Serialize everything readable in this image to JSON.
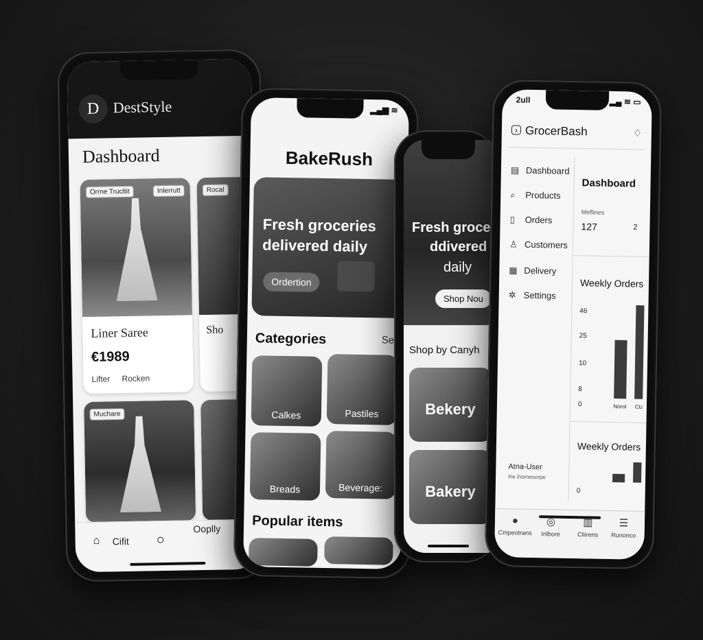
{
  "deststyle": {
    "logo_letter": "D",
    "brand": "DestStyle",
    "title": "Dashboard",
    "card1": {
      "tag_left": "Orrne Trucltit",
      "tag_right": "Inlerrutt",
      "name": "Liner Saree",
      "price": "€1989",
      "meta1": "Lifter",
      "meta2": "Rocken"
    },
    "card2": {
      "tag": "Rocal",
      "name": "Sho"
    },
    "card3": {
      "tag": "Muchare"
    },
    "nav": {
      "home_label": "Cifit",
      "other_label": "Ooplly"
    }
  },
  "bakerush": {
    "brand": "BakeRush",
    "hero_title_line1": "Fresh groceries",
    "hero_title_line2": "delivered daily",
    "hero_button": "Ordertion",
    "categories_title": "Categories",
    "see_all": "See",
    "categories": [
      "Calkes",
      "Pastiles",
      "Breads",
      "Beverage:"
    ],
    "popular_title": "Popular items"
  },
  "grocer_hero": {
    "title_line1": "Fresh groce",
    "title_line2": "ddivered",
    "title_line3": "daily",
    "button": "Shop Nou",
    "section_title": "Shop by Canyh",
    "tiles": [
      "Bekery",
      "Bakery"
    ]
  },
  "grocerbash": {
    "status_time": "2ull",
    "brand": "GrocerBash",
    "sidebar": [
      "Dashboard",
      "Products",
      "Orders",
      "Customers",
      "Delivery",
      "Settings"
    ],
    "main_title": "Dashboard",
    "stat_label": "Meflines",
    "stat_value": "127",
    "stat_side": "2",
    "chart1_title": "Weekly Orders",
    "chart2_title": "Weekly Orders",
    "user_name": "Atna-User",
    "user_sub": "ihe ihomesorpe",
    "nav": [
      "Cmpeotrans",
      "Inlbore",
      "Cliirens",
      "Runonco"
    ]
  },
  "chart_data": [
    {
      "type": "bar",
      "title": "Weekly Orders",
      "categories": [
        "Norol",
        "Ctall"
      ],
      "values": [
        15,
        24
      ],
      "yticks": [
        "46",
        "25",
        "10",
        "8",
        "0"
      ]
    },
    {
      "type": "bar",
      "title": "Weekly Orders",
      "categories": [
        "",
        ""
      ],
      "values": [
        5,
        12
      ],
      "yticks": [
        "0"
      ]
    }
  ],
  "colors": {
    "background": "#1b1b1b",
    "bar": "#3c3c3c",
    "screen": "#f3f3f3"
  }
}
